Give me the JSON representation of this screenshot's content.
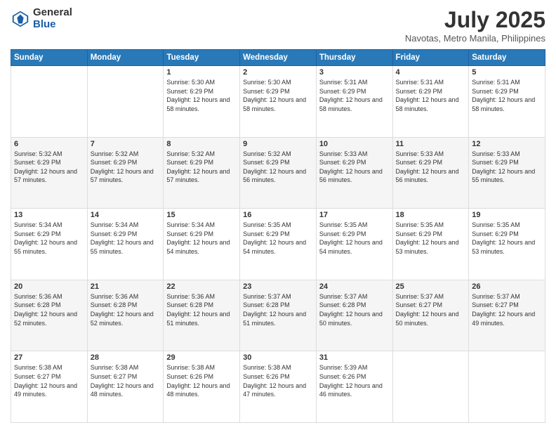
{
  "logo": {
    "general": "General",
    "blue": "Blue"
  },
  "header": {
    "title": "July 2025",
    "subtitle": "Navotas, Metro Manila, Philippines"
  },
  "weekdays": [
    "Sunday",
    "Monday",
    "Tuesday",
    "Wednesday",
    "Thursday",
    "Friday",
    "Saturday"
  ],
  "weeks": [
    [
      {
        "day": "",
        "sunrise": "",
        "sunset": "",
        "daylight": ""
      },
      {
        "day": "",
        "sunrise": "",
        "sunset": "",
        "daylight": ""
      },
      {
        "day": "1",
        "sunrise": "Sunrise: 5:30 AM",
        "sunset": "Sunset: 6:29 PM",
        "daylight": "Daylight: 12 hours and 58 minutes."
      },
      {
        "day": "2",
        "sunrise": "Sunrise: 5:30 AM",
        "sunset": "Sunset: 6:29 PM",
        "daylight": "Daylight: 12 hours and 58 minutes."
      },
      {
        "day": "3",
        "sunrise": "Sunrise: 5:31 AM",
        "sunset": "Sunset: 6:29 PM",
        "daylight": "Daylight: 12 hours and 58 minutes."
      },
      {
        "day": "4",
        "sunrise": "Sunrise: 5:31 AM",
        "sunset": "Sunset: 6:29 PM",
        "daylight": "Daylight: 12 hours and 58 minutes."
      },
      {
        "day": "5",
        "sunrise": "Sunrise: 5:31 AM",
        "sunset": "Sunset: 6:29 PM",
        "daylight": "Daylight: 12 hours and 58 minutes."
      }
    ],
    [
      {
        "day": "6",
        "sunrise": "Sunrise: 5:32 AM",
        "sunset": "Sunset: 6:29 PM",
        "daylight": "Daylight: 12 hours and 57 minutes."
      },
      {
        "day": "7",
        "sunrise": "Sunrise: 5:32 AM",
        "sunset": "Sunset: 6:29 PM",
        "daylight": "Daylight: 12 hours and 57 minutes."
      },
      {
        "day": "8",
        "sunrise": "Sunrise: 5:32 AM",
        "sunset": "Sunset: 6:29 PM",
        "daylight": "Daylight: 12 hours and 57 minutes."
      },
      {
        "day": "9",
        "sunrise": "Sunrise: 5:32 AM",
        "sunset": "Sunset: 6:29 PM",
        "daylight": "Daylight: 12 hours and 56 minutes."
      },
      {
        "day": "10",
        "sunrise": "Sunrise: 5:33 AM",
        "sunset": "Sunset: 6:29 PM",
        "daylight": "Daylight: 12 hours and 56 minutes."
      },
      {
        "day": "11",
        "sunrise": "Sunrise: 5:33 AM",
        "sunset": "Sunset: 6:29 PM",
        "daylight": "Daylight: 12 hours and 56 minutes."
      },
      {
        "day": "12",
        "sunrise": "Sunrise: 5:33 AM",
        "sunset": "Sunset: 6:29 PM",
        "daylight": "Daylight: 12 hours and 55 minutes."
      }
    ],
    [
      {
        "day": "13",
        "sunrise": "Sunrise: 5:34 AM",
        "sunset": "Sunset: 6:29 PM",
        "daylight": "Daylight: 12 hours and 55 minutes."
      },
      {
        "day": "14",
        "sunrise": "Sunrise: 5:34 AM",
        "sunset": "Sunset: 6:29 PM",
        "daylight": "Daylight: 12 hours and 55 minutes."
      },
      {
        "day": "15",
        "sunrise": "Sunrise: 5:34 AM",
        "sunset": "Sunset: 6:29 PM",
        "daylight": "Daylight: 12 hours and 54 minutes."
      },
      {
        "day": "16",
        "sunrise": "Sunrise: 5:35 AM",
        "sunset": "Sunset: 6:29 PM",
        "daylight": "Daylight: 12 hours and 54 minutes."
      },
      {
        "day": "17",
        "sunrise": "Sunrise: 5:35 AM",
        "sunset": "Sunset: 6:29 PM",
        "daylight": "Daylight: 12 hours and 54 minutes."
      },
      {
        "day": "18",
        "sunrise": "Sunrise: 5:35 AM",
        "sunset": "Sunset: 6:29 PM",
        "daylight": "Daylight: 12 hours and 53 minutes."
      },
      {
        "day": "19",
        "sunrise": "Sunrise: 5:35 AM",
        "sunset": "Sunset: 6:29 PM",
        "daylight": "Daylight: 12 hours and 53 minutes."
      }
    ],
    [
      {
        "day": "20",
        "sunrise": "Sunrise: 5:36 AM",
        "sunset": "Sunset: 6:28 PM",
        "daylight": "Daylight: 12 hours and 52 minutes."
      },
      {
        "day": "21",
        "sunrise": "Sunrise: 5:36 AM",
        "sunset": "Sunset: 6:28 PM",
        "daylight": "Daylight: 12 hours and 52 minutes."
      },
      {
        "day": "22",
        "sunrise": "Sunrise: 5:36 AM",
        "sunset": "Sunset: 6:28 PM",
        "daylight": "Daylight: 12 hours and 51 minutes."
      },
      {
        "day": "23",
        "sunrise": "Sunrise: 5:37 AM",
        "sunset": "Sunset: 6:28 PM",
        "daylight": "Daylight: 12 hours and 51 minutes."
      },
      {
        "day": "24",
        "sunrise": "Sunrise: 5:37 AM",
        "sunset": "Sunset: 6:28 PM",
        "daylight": "Daylight: 12 hours and 50 minutes."
      },
      {
        "day": "25",
        "sunrise": "Sunrise: 5:37 AM",
        "sunset": "Sunset: 6:27 PM",
        "daylight": "Daylight: 12 hours and 50 minutes."
      },
      {
        "day": "26",
        "sunrise": "Sunrise: 5:37 AM",
        "sunset": "Sunset: 6:27 PM",
        "daylight": "Daylight: 12 hours and 49 minutes."
      }
    ],
    [
      {
        "day": "27",
        "sunrise": "Sunrise: 5:38 AM",
        "sunset": "Sunset: 6:27 PM",
        "daylight": "Daylight: 12 hours and 49 minutes."
      },
      {
        "day": "28",
        "sunrise": "Sunrise: 5:38 AM",
        "sunset": "Sunset: 6:27 PM",
        "daylight": "Daylight: 12 hours and 48 minutes."
      },
      {
        "day": "29",
        "sunrise": "Sunrise: 5:38 AM",
        "sunset": "Sunset: 6:26 PM",
        "daylight": "Daylight: 12 hours and 48 minutes."
      },
      {
        "day": "30",
        "sunrise": "Sunrise: 5:38 AM",
        "sunset": "Sunset: 6:26 PM",
        "daylight": "Daylight: 12 hours and 47 minutes."
      },
      {
        "day": "31",
        "sunrise": "Sunrise: 5:39 AM",
        "sunset": "Sunset: 6:26 PM",
        "daylight": "Daylight: 12 hours and 46 minutes."
      },
      {
        "day": "",
        "sunrise": "",
        "sunset": "",
        "daylight": ""
      },
      {
        "day": "",
        "sunrise": "",
        "sunset": "",
        "daylight": ""
      }
    ]
  ]
}
